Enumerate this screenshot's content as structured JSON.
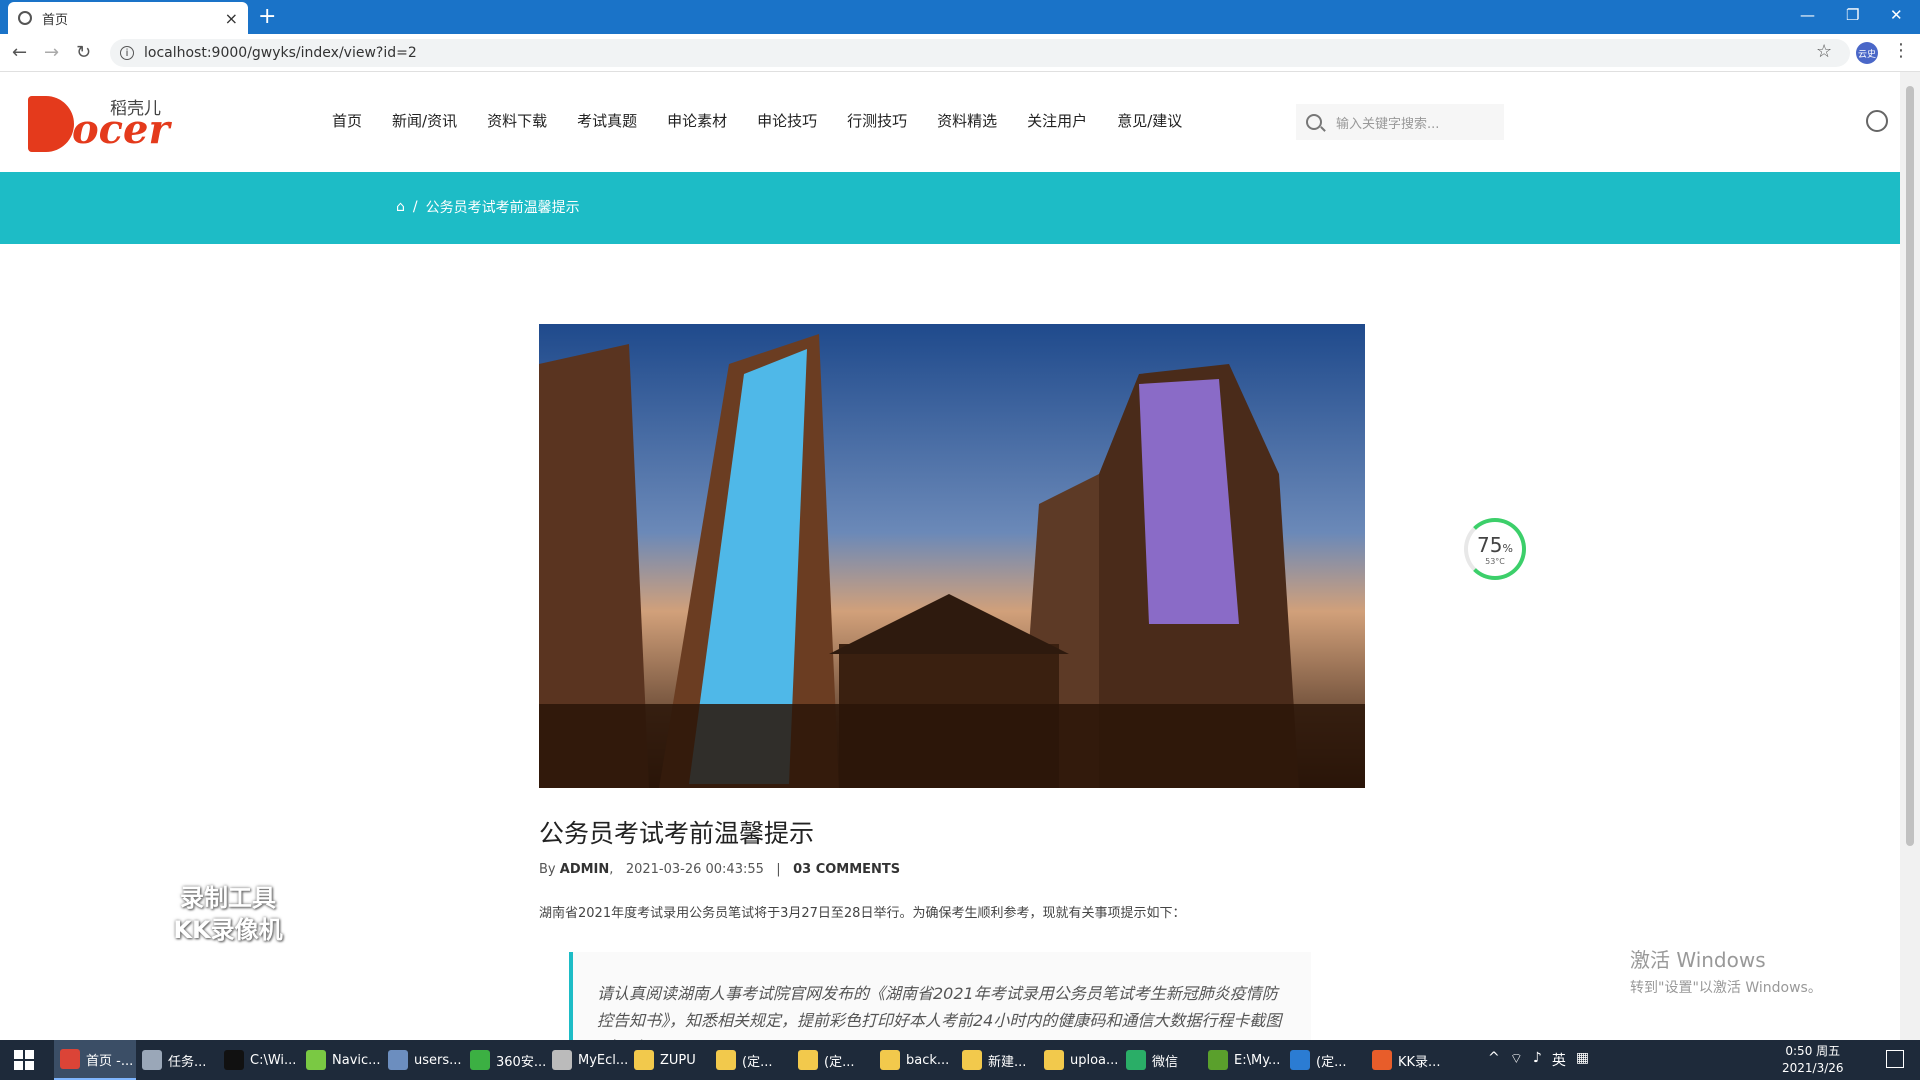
{
  "browser": {
    "tab_title": "首页",
    "new_tab": "+",
    "tab_close": "×",
    "url": "localhost:9000/gwyks/index/view?id=2",
    "profile_initials": "云史"
  },
  "site": {
    "logo_cn": "稻壳儿",
    "logo_en": "ocer",
    "nav": [
      "首页",
      "新闻/资讯",
      "资料下载",
      "考试真题",
      "申论素材",
      "申论技巧",
      "行测技巧",
      "资料精选",
      "关注用户",
      "意见/建议"
    ],
    "search_placeholder": "输入关键字搜索...",
    "breadcrumb_current": "公务员考试考前温馨提示",
    "breadcrumb_sep": "/"
  },
  "article": {
    "title": "公务员考试考前温馨提示",
    "by": "By",
    "author": "ADMIN",
    "date": "2021-03-26 00:43:55",
    "sep": "|",
    "comments": "03 COMMENTS",
    "intro": "湖南省2021年度考试录用公务员笔试将于3月27日至28日举行。为确保考生顺利参考，现就有关事项提示如下：",
    "quote": "请认真阅读湖南人事考试院官网发布的《湖南省2021年考试录用公务员笔试考生新冠肺炎疫情防控告知书》，知悉相关规定，提前彩色打印好本人考前24小时内的健康码和通信大数据行程卡截图（图片"
  },
  "overlays": {
    "gauge_value": "75",
    "gauge_unit": "%",
    "gauge_temp": "53°C",
    "recorder_watermark": "录制工具 KK录像机",
    "activate_title": "激活 Windows",
    "activate_sub": "转到\"设置\"以激活 Windows。"
  },
  "taskbar": {
    "items": [
      {
        "label": "首页 -...",
        "color": "#db4437"
      },
      {
        "label": "任务...",
        "color": "#9aa7b8"
      },
      {
        "label": "C:\\Wi...",
        "color": "#111111"
      },
      {
        "label": "Navic...",
        "color": "#7ac943"
      },
      {
        "label": "users...",
        "color": "#6c8ebf"
      },
      {
        "label": "360安...",
        "color": "#3cb043"
      },
      {
        "label": "MyEcl...",
        "color": "#bbbbbb"
      },
      {
        "label": "ZUPU",
        "color": "#f2c94c"
      },
      {
        "label": "(定...",
        "color": "#f2c94c"
      },
      {
        "label": "(定...",
        "color": "#f2c94c"
      },
      {
        "label": "back...",
        "color": "#f2c94c"
      },
      {
        "label": "新建...",
        "color": "#f2c94c"
      },
      {
        "label": "uploa...",
        "color": "#f2c94c"
      },
      {
        "label": "微信",
        "color": "#2aae67"
      },
      {
        "label": "E:\\My...",
        "color": "#5aa02c"
      },
      {
        "label": "(定...",
        "color": "#2b7cd3"
      },
      {
        "label": "KK录...",
        "color": "#e85d2a"
      }
    ],
    "tray_lang": "英",
    "clock_time": "0:50 周五",
    "clock_date": "2021/3/26"
  }
}
